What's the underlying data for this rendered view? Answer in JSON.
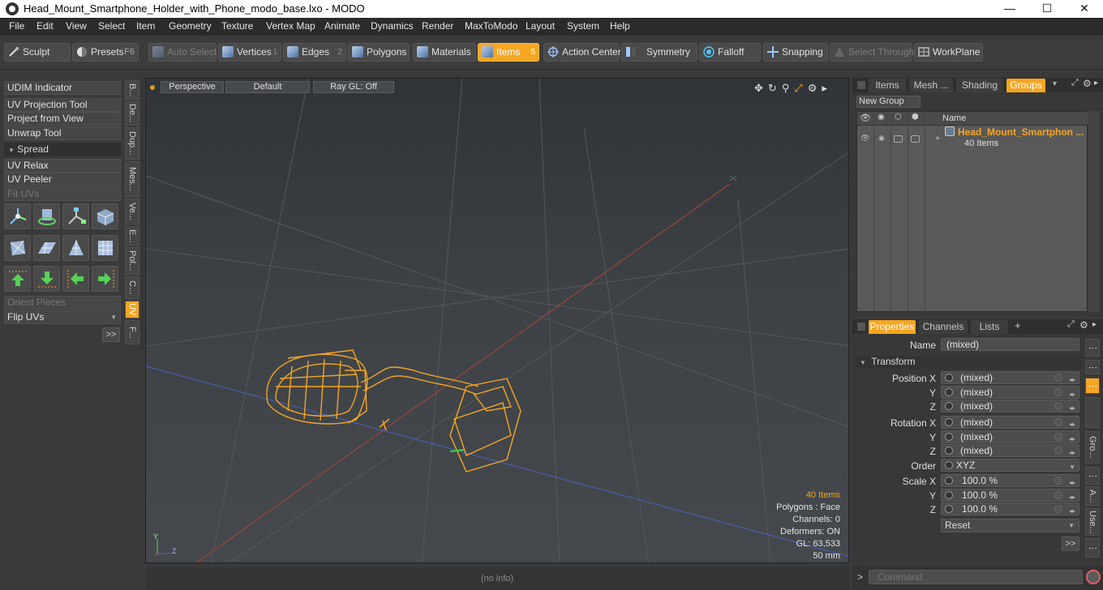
{
  "window": {
    "title": "Head_Mount_Smartphone_Holder_with_Phone_modo_base.lxo - MODO",
    "minimize": "—",
    "maximize": "☐",
    "close": "✕"
  },
  "menu": [
    "File",
    "Edit",
    "View",
    "Select",
    "Item",
    "Geometry",
    "Texture",
    "Vertex Map",
    "Animate",
    "Dynamics",
    "Render",
    "MaxToModo",
    "Layout",
    "System",
    "Help"
  ],
  "toolbar": {
    "sculpt": "Sculpt",
    "presets": "Presets",
    "presets_key": "F6",
    "auto_select": "Auto Select",
    "vertices": "Vertices",
    "vertices_num": "1",
    "edges": "Edges",
    "edges_num": "2",
    "polygons": "Polygons",
    "materials": "Materials",
    "items": "Items",
    "items_num": "5",
    "action_center": "Action Center",
    "symmetry": "Symmetry",
    "falloff": "Falloff",
    "snapping": "Snapping",
    "select_through": "Select Through",
    "workplane": "WorkPlane"
  },
  "left_panel": {
    "udim": "UDIM Indicator",
    "uv_projection": "UV Projection Tool",
    "project_from_view": "Project from View",
    "unwrap": "Unwrap Tool",
    "spread": "Spread",
    "uv_relax": "UV Relax",
    "uv_peeler": "UV Peeler",
    "fit_uvs": "Fit UVs",
    "orient_pieces": "Orient Pieces",
    "flip_uvs": "Flip UVs",
    "more": ">>",
    "vtabs": [
      "B...",
      "De...",
      "Dup...",
      "Mes...",
      "Ve...",
      "E...",
      "Pol...",
      "C...",
      "UV",
      "F..."
    ]
  },
  "viewport": {
    "perspective": "Perspective",
    "default": "Default",
    "raygl": "Ray GL: Off",
    "stats": {
      "items": "40 Items",
      "polygons": "Polygons : Face",
      "channels": "Channels: 0",
      "deformers": "Deformers: ON",
      "gl": "GL: 63,533",
      "mm": "50 mm"
    },
    "axis_y": "Y",
    "axis_z": "Z"
  },
  "status": "(no info)",
  "groups_panel": {
    "tabs": [
      "Items",
      "Mesh ...",
      "Shading",
      "Groups"
    ],
    "active_tab": "Groups",
    "new_group": "New Group",
    "name_col": "Name",
    "group_name": "Head_Mount_Smartphon ...",
    "group_count": "40 Items"
  },
  "props_panel": {
    "tabs": [
      "Properties",
      "Channels",
      "Lists"
    ],
    "add": "+",
    "name_label": "Name",
    "name_value": "(mixed)",
    "transform": "Transform",
    "rows": [
      {
        "label": "Position X",
        "value": "(mixed)"
      },
      {
        "label": "Y",
        "value": "(mixed)"
      },
      {
        "label": "Z",
        "value": "(mixed)"
      },
      {
        "label": "Rotation X",
        "value": "(mixed)"
      },
      {
        "label": "Y",
        "value": "(mixed)"
      },
      {
        "label": "Z",
        "value": "(mixed)"
      },
      {
        "label": "Order",
        "value": "XYZ"
      },
      {
        "label": "Scale X",
        "value": "100.0 %"
      },
      {
        "label": "Y",
        "value": "100.0 %"
      },
      {
        "label": "Z",
        "value": "100.0 %"
      }
    ],
    "reset": "Reset",
    "more": ">>",
    "side_tabs": [
      "Gro...",
      "A...",
      "Use..."
    ]
  },
  "command": {
    "placeholder": "Command",
    "prompt": ">"
  },
  "colors": {
    "accent": "#f5a623",
    "bg": "#3a3a3a",
    "model": "#f5a623"
  }
}
